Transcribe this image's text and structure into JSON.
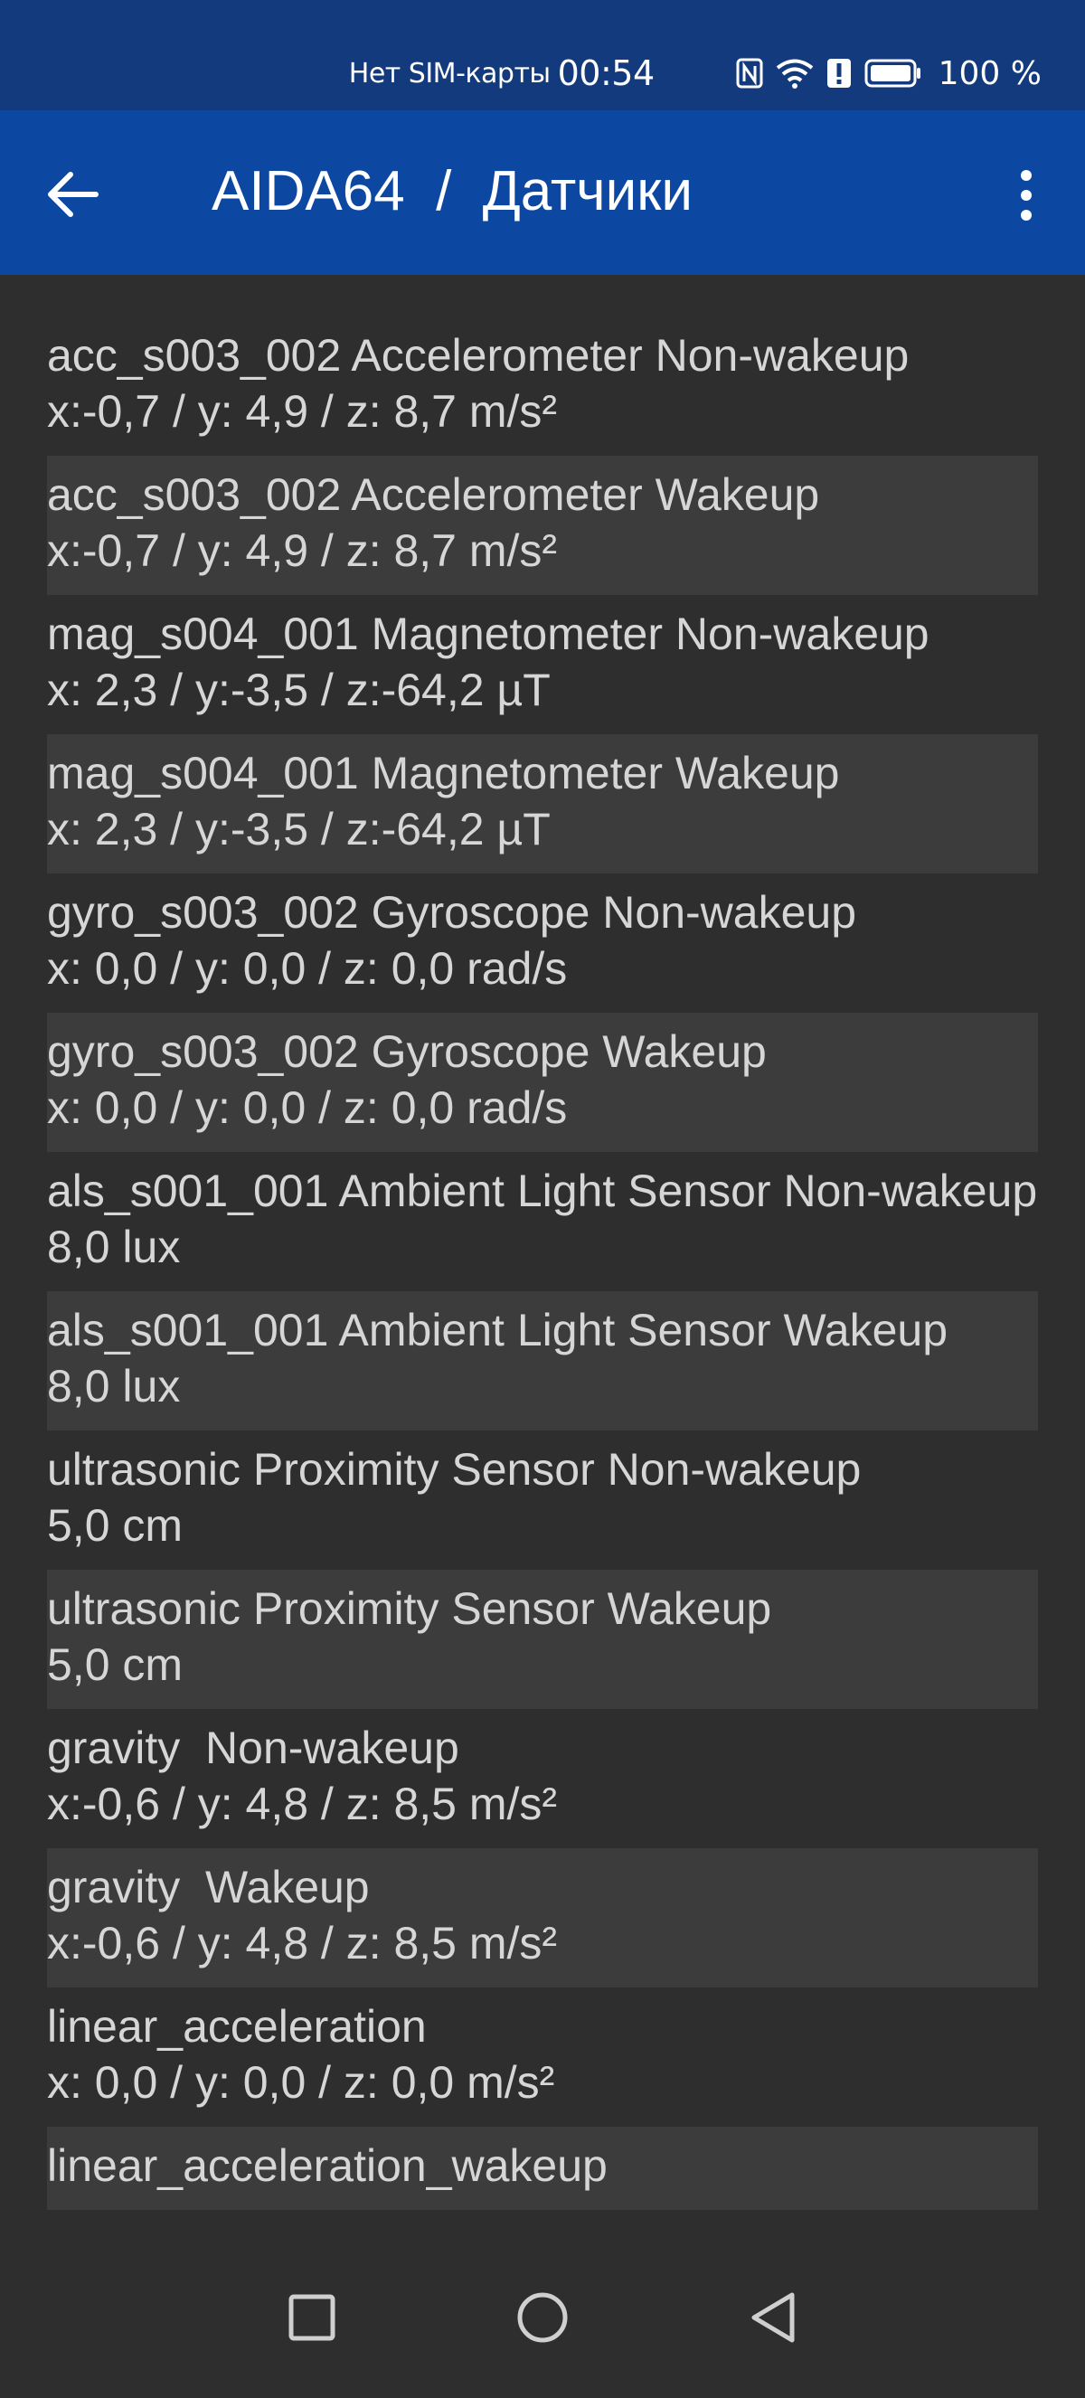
{
  "status_bar": {
    "carrier": "Нет SIM-карты",
    "time": "00:54",
    "battery": "100 %",
    "icons": [
      "nfc-icon",
      "wifi-icon",
      "alert-icon",
      "battery-icon"
    ]
  },
  "app_bar": {
    "title": "AIDA64  /  Датчики",
    "back_icon": "arrow-left-icon",
    "menu_icon": "more-vert-icon"
  },
  "sensors": [
    {
      "name": "acc_s003_002 Accelerometer Non-wakeup",
      "value": "x:-0,7 / y: 4,9 / z: 8,7 m/s²"
    },
    {
      "name": "acc_s003_002 Accelerometer Wakeup",
      "value": "x:-0,7 / y: 4,9 / z: 8,7 m/s²"
    },
    {
      "name": "mag_s004_001 Magnetometer Non-wakeup",
      "value": "x: 2,3 / y:-3,5 / z:-64,2 µT"
    },
    {
      "name": "mag_s004_001 Magnetometer Wakeup",
      "value": "x: 2,3 / y:-3,5 / z:-64,2 µT"
    },
    {
      "name": "gyro_s003_002 Gyroscope Non-wakeup",
      "value": "x: 0,0 / y: 0,0 / z: 0,0 rad/s"
    },
    {
      "name": "gyro_s003_002 Gyroscope Wakeup",
      "value": "x: 0,0 / y: 0,0 / z: 0,0 rad/s"
    },
    {
      "name": "als_s001_001 Ambient Light Sensor Non-wakeup",
      "value": "8,0 lux"
    },
    {
      "name": "als_s001_001 Ambient Light Sensor Wakeup",
      "value": "8,0 lux"
    },
    {
      "name": "ultrasonic Proximity Sensor Non-wakeup",
      "value": "5,0 cm"
    },
    {
      "name": "ultrasonic Proximity Sensor Wakeup",
      "value": "5,0 cm"
    },
    {
      "name": "gravity  Non-wakeup",
      "value": "x:-0,6 / y: 4,8 / z: 8,5 m/s²"
    },
    {
      "name": "gravity  Wakeup",
      "value": "x:-0,6 / y: 4,8 / z: 8,5 m/s²"
    },
    {
      "name": "linear_acceleration",
      "value": "x: 0,0 / y: 0,0 / z: 0,0 m/s²"
    },
    {
      "name": "linear_acceleration_wakeup",
      "value": ""
    }
  ],
  "nav_bar": {
    "recents_icon": "square-recents-icon",
    "home_icon": "circle-home-icon",
    "back_icon": "triangle-back-icon"
  },
  "colors": {
    "status_bar": "#123a7c",
    "app_bar": "#0c47a1",
    "background": "#2e2e2e",
    "row_alt": "#3c3c3c",
    "text": "#d6d6d6"
  }
}
